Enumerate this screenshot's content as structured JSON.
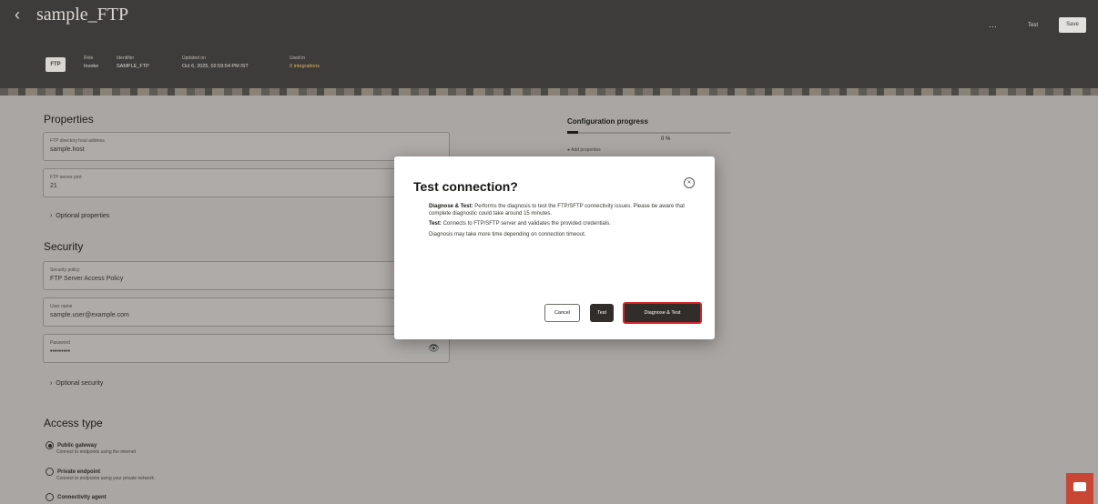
{
  "header": {
    "back_icon": "chevron-left-icon",
    "title": "sample_FTP",
    "badge": "FTP",
    "meta": [
      {
        "label": "Role",
        "value": "Invoke"
      },
      {
        "label": "Identifier",
        "value": "SAMPLE_FTP"
      },
      {
        "label": "Updated on",
        "value": "Oct 6, 2025, 02:59:54 PM IST"
      },
      {
        "label": "Used in",
        "value": "0 integrations"
      }
    ],
    "more_icon": "more-horizontal-icon",
    "test_label": "Test",
    "save_label": "Save"
  },
  "properties": {
    "title": "Properties",
    "fields": [
      {
        "label": "FTP directory host address",
        "value": "sample.host"
      },
      {
        "label": "FTP server port",
        "value": "21"
      }
    ],
    "optional_label": "Optional properties"
  },
  "security": {
    "title": "Security",
    "fields": [
      {
        "label": "Security policy",
        "value": "FTP Server Access Policy"
      },
      {
        "label": "User name",
        "value": "sample.user@example.com"
      },
      {
        "label": "Password",
        "value": "•••••••••"
      }
    ],
    "optional_label": "Optional security"
  },
  "access_type": {
    "title": "Access type",
    "options": [
      {
        "label": "Public gateway",
        "desc": "Connect to endpoints using the internet",
        "selected": true
      },
      {
        "label": "Private endpoint",
        "desc": "Connect to endpoints using your private network",
        "selected": false
      },
      {
        "label": "Connectivity agent",
        "desc": "",
        "selected": false
      }
    ]
  },
  "progress": {
    "title": "Configuration progress",
    "percent_text": "0 %",
    "percent": 0,
    "step": "Add properties"
  },
  "dialog": {
    "title": "Test connection?",
    "close_icon": "close-icon",
    "diagnose_text_bold": "Diagnose & Test:",
    "diagnose_text": "Performs the diagnosis to test the FTP/SFTP connectivity issues. Please be aware that complete diagnostic could take around 15 minutes.",
    "test_text_bold": "Test:",
    "test_text": "Connects to FTP/SFTP server and validates the provided credentials.",
    "note": "Diagnosis may take more time depending on connection timeout.",
    "cancel_label": "Cancel",
    "test_label": "Test",
    "diagnose_label": "Diagnose & Test"
  },
  "chat_icon": "chat-icon",
  "colors": {
    "header_bg": "#3e3c3a",
    "primary_button": "#312d2a",
    "highlight": "#d2262b",
    "chat": "#c74634"
  }
}
